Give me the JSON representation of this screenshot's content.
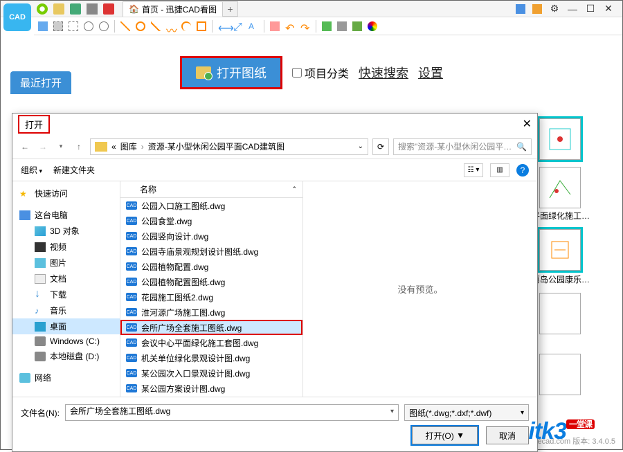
{
  "titlebar": {
    "tab_home": "首页 - 迅捷CAD看图",
    "add_tab": "+"
  },
  "main": {
    "recent_tab": "最近打开",
    "open_drawing": "打开图纸",
    "project_category": "项目分类",
    "quick_search": "快速搜索",
    "settings": "设置"
  },
  "thumbs": {
    "label1": "…平面绿化施工…",
    "label2": "…葛岛公园康乐…"
  },
  "dialog": {
    "title": "打开",
    "breadcrumb": {
      "root": "图库",
      "folder": "资源-某小型休闲公园平面CAD建筑图",
      "prefix": "«"
    },
    "search_placeholder": "搜索\"资源-某小型休闲公园平…",
    "organize": "组织",
    "new_folder": "新建文件夹",
    "col_name": "名称",
    "no_preview": "没有预览。",
    "sidebar": {
      "quick": "快速访问",
      "pc": "这台电脑",
      "items": [
        "3D 对象",
        "视频",
        "图片",
        "文档",
        "下载",
        "音乐",
        "桌面",
        "Windows (C:)",
        "本地磁盘 (D:)"
      ],
      "network": "网络"
    },
    "files": [
      "公园入口施工图纸.dwg",
      "公园食堂.dwg",
      "公园竖向设计.dwg",
      "公园寺庙景观规划设计图纸.dwg",
      "公园植物配置.dwg",
      "公园植物配置图纸.dwg",
      "花园施工图纸2.dwg",
      "淮河源广场施工图.dwg",
      "会所广场全套施工图纸.dwg",
      "会议中心平面绿化施工套图.dwg",
      "机关单位绿化景观设计图.dwg",
      "某公园次入口景观设计图.dwg",
      "某公园方案设计图.dwg"
    ],
    "selected_index": 8,
    "filename_label": "文件名(N):",
    "filename_value": "会所广场全套施工图纸.dwg",
    "filter": "图纸(*.dwg;*.dxf;*.dwf)",
    "open_btn": "打开(O)",
    "cancel_btn": "取消"
  },
  "watermark": {
    "text": "迅捷CAD: www.xunjiecad.com 版本: 3.4.0.5",
    "logo": "itk3",
    "logo_sup": "一堂课"
  }
}
